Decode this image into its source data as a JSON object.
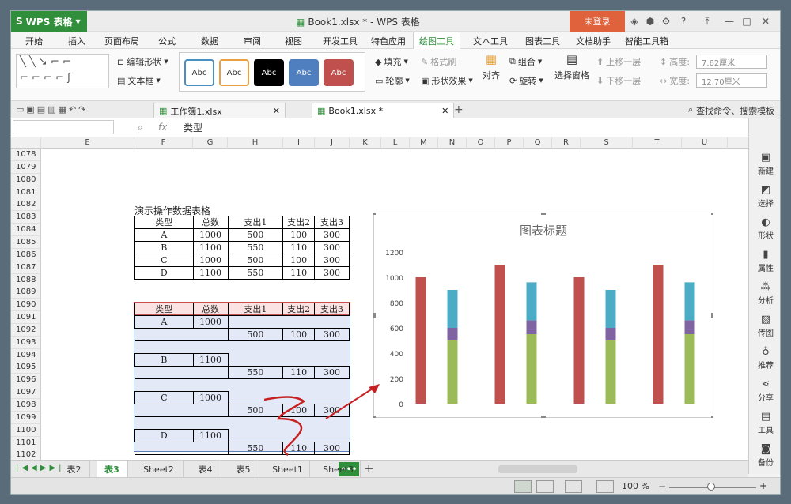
{
  "app": {
    "brand": "WPS 表格",
    "doc_title": "Book1.xlsx * - WPS 表格",
    "login": "未登录"
  },
  "menus": [
    "开始",
    "插入",
    "页面布局",
    "公式",
    "数据",
    "审阅",
    "视图",
    "开发工具",
    "特色应用",
    "绘图工具",
    "文本工具",
    "图表工具",
    "文档助手",
    "智能工具箱"
  ],
  "ribbon": {
    "edit_shape": "编辑形状",
    "text_box": "文本框",
    "style_abc": [
      "Abc",
      "Abc",
      "Abc",
      "Abc",
      "Abc"
    ],
    "fill": "填充",
    "format_brush": "格式刷",
    "outline": "轮廓",
    "shape_effect": "形状效果",
    "align": "对齐",
    "group": "组合",
    "rotate": "旋转",
    "select_pane": "选择窗格",
    "bring_forward": "上移一层",
    "send_backward": "下移一层",
    "height_label": "高度:",
    "height_value": "7.62厘米",
    "width_label": "宽度:",
    "width_value": "12.70厘米"
  },
  "doc_tabs": [
    "工作簿1.xlsx",
    "Book1.xlsx *"
  ],
  "search": "查找命令、搜索模板",
  "formula": {
    "fx": "fx",
    "content": "类型"
  },
  "columns": [
    "E",
    "F",
    "G",
    "H",
    "I",
    "J",
    "K",
    "L",
    "M",
    "N",
    "O",
    "P",
    "Q",
    "R",
    "S",
    "T",
    "U"
  ],
  "rows": [
    "1078",
    "1079",
    "1080",
    "1081",
    "1082",
    "1083",
    "1084",
    "1085",
    "1086",
    "1087",
    "1088",
    "1089",
    "1090",
    "1091",
    "1092",
    "1093",
    "1094",
    "1095",
    "1096",
    "1097",
    "1098",
    "1099",
    "1100",
    "1101",
    "1102",
    "1103"
  ],
  "table1": {
    "title": "演示操作数据表格",
    "headers": [
      "类型",
      "总数",
      "支出1",
      "支出2",
      "支出3"
    ],
    "rows": [
      [
        "A",
        "1000",
        "500",
        "100",
        "300"
      ],
      [
        "B",
        "1100",
        "550",
        "110",
        "300"
      ],
      [
        "C",
        "1000",
        "500",
        "100",
        "300"
      ],
      [
        "D",
        "1100",
        "550",
        "110",
        "300"
      ]
    ]
  },
  "table2": {
    "headers": [
      "类型",
      "总数",
      "支出1",
      "支出2",
      "支出3"
    ],
    "blocks": [
      {
        "type": "A",
        "total": "1000",
        "e1": "500",
        "e2": "100",
        "e3": "300"
      },
      {
        "type": "B",
        "total": "1100",
        "e1": "550",
        "e2": "110",
        "e3": "300"
      },
      {
        "type": "C",
        "total": "1000",
        "e1": "500",
        "e2": "100",
        "e3": "300"
      },
      {
        "type": "D",
        "total": "1100",
        "e1": "550",
        "e2": "110",
        "e3": "300"
      }
    ]
  },
  "sidebar": [
    "新建",
    "选择",
    "形状",
    "属性",
    "分析",
    "传图",
    "推荐",
    "分享",
    "工具",
    "备份"
  ],
  "sheet_tabs": [
    "表2",
    "表3",
    "Sheet2",
    "表4",
    "表5",
    "Sheet1",
    "Sheet3"
  ],
  "status": {
    "zoom": "100 %"
  },
  "colors": {
    "total": "#c0504d",
    "exp1": "#9bbb59",
    "exp2": "#8064a2",
    "exp3": "#4bacc6"
  },
  "chart_data": {
    "type": "bar",
    "title": "图表标题",
    "ylim": [
      0,
      1200
    ],
    "yticks": [
      0,
      200,
      400,
      600,
      800,
      1000,
      1200
    ],
    "grid": false,
    "stacks": [
      {
        "total": 1000
      },
      {
        "exp1": 500,
        "exp2": 100,
        "exp3": 300
      },
      {
        "total": 1100
      },
      {
        "exp1": 550,
        "exp2": 110,
        "exp3": 300
      },
      {
        "total": 1000
      },
      {
        "exp1": 500,
        "exp2": 100,
        "exp3": 300
      },
      {
        "total": 1100
      },
      {
        "exp1": 550,
        "exp2": 110,
        "exp3": 300
      }
    ]
  }
}
